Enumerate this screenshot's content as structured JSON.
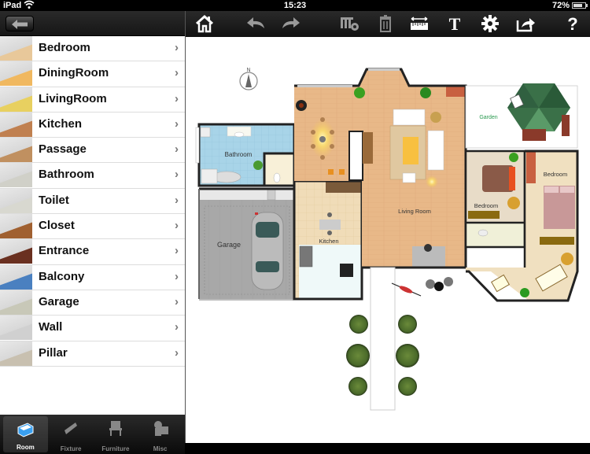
{
  "status_bar": {
    "device": "iPad",
    "wifi_icon": "wifi-icon",
    "time": "15:23",
    "battery_percent": "72%",
    "battery_level": 0.72
  },
  "sidebar": {
    "back_icon": "back-arrow-icon",
    "items": [
      {
        "label": "Bedroom",
        "thumb_color": "#e8c89a"
      },
      {
        "label": "DiningRoom",
        "thumb_color": "#f0b860"
      },
      {
        "label": "LivingRoom",
        "thumb_color": "#e8d060"
      },
      {
        "label": "Kitchen",
        "thumb_color": "#c08050"
      },
      {
        "label": "Passage",
        "thumb_color": "#c09060"
      },
      {
        "label": "Bathroom",
        "thumb_color": "#d0d0c8"
      },
      {
        "label": "Toilet",
        "thumb_color": "#d8d8d0"
      },
      {
        "label": "Closet",
        "thumb_color": "#a06030"
      },
      {
        "label": "Entrance",
        "thumb_color": "#6a3020"
      },
      {
        "label": "Balcony",
        "thumb_color": "#4a80c0"
      },
      {
        "label": "Garage",
        "thumb_color": "#c8c8b8"
      },
      {
        "label": "Wall",
        "thumb_color": "#d0d0d0"
      },
      {
        "label": "Pillar",
        "thumb_color": "#c8c0b0"
      }
    ],
    "chevron": "›"
  },
  "tabbar": {
    "tabs": [
      {
        "label": "Room",
        "icon": "room-icon",
        "active": true
      },
      {
        "label": "Fixture",
        "icon": "fixture-icon",
        "active": false
      },
      {
        "label": "Furniture",
        "icon": "chair-icon",
        "active": false
      },
      {
        "label": "Misc",
        "icon": "misc-icon",
        "active": false
      }
    ]
  },
  "toolbar": {
    "buttons": [
      {
        "name": "home",
        "icon": "home-icon"
      },
      {
        "name": "undo",
        "icon": "undo-icon"
      },
      {
        "name": "redo",
        "icon": "redo-icon"
      },
      {
        "name": "layer-settings",
        "icon": "layer-settings-icon"
      },
      {
        "name": "delete",
        "icon": "trash-icon"
      },
      {
        "name": "measure",
        "icon": "ruler-icon"
      },
      {
        "name": "text",
        "icon": "text-icon",
        "glyph": "T"
      },
      {
        "name": "settings",
        "icon": "gear-icon"
      },
      {
        "name": "share",
        "icon": "share-icon"
      },
      {
        "name": "help",
        "icon": "help-icon",
        "glyph": "?"
      }
    ]
  },
  "floorplan": {
    "compass_label": "N",
    "rooms": [
      {
        "label": "Bathroom"
      },
      {
        "label": "Garage"
      },
      {
        "label": "Kitchen"
      },
      {
        "label": "Living Room"
      },
      {
        "label": "Garden"
      },
      {
        "label": "Bedroom"
      },
      {
        "label": "Bedroom"
      }
    ],
    "colors": {
      "wood_floor": "#e8b888",
      "bathroom_floor": "#a8d4e8",
      "garage_floor": "#a8a8a8",
      "kitchen_tile": "#f0dcb8",
      "bedroom_carpet": "#e8dcc8",
      "bedroom2_floor": "#f0e0c0",
      "wall": "#222222",
      "tree": "#4a6a2a",
      "umbrella": "#3a8050",
      "garden_label": "#2a9a50"
    }
  }
}
